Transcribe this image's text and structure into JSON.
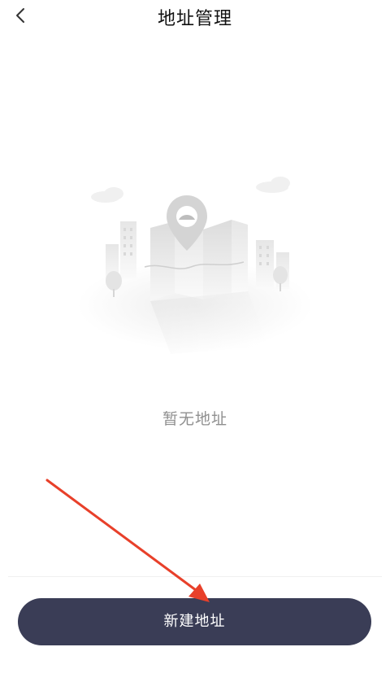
{
  "header": {
    "title": "地址管理",
    "back_icon": "chevron-left-icon"
  },
  "empty_state": {
    "illustration": "city-map-pin-illustration",
    "message": "暂无地址"
  },
  "footer": {
    "new_address_label": "新建地址",
    "button_color": "#3a3d56"
  },
  "annotation": {
    "arrow_color": "#e8402a"
  }
}
